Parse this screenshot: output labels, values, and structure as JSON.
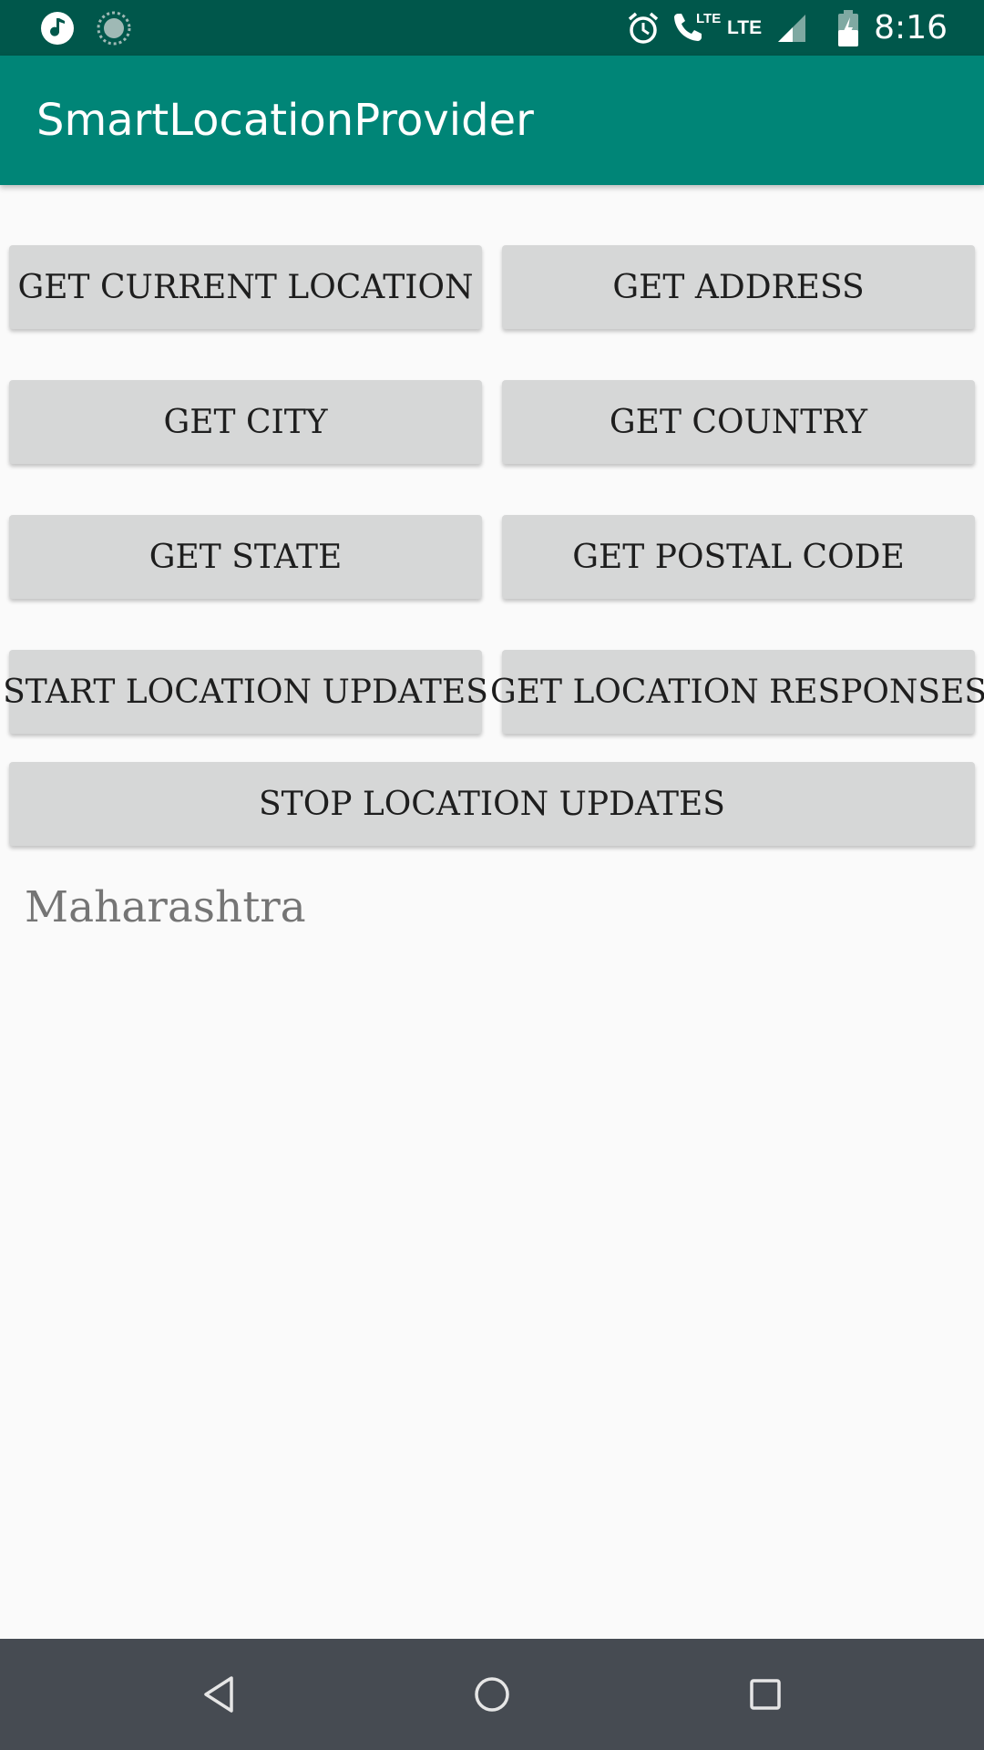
{
  "status_bar": {
    "time": "8:16",
    "lte_label": "LTE",
    "lte_small_label": "LTE",
    "icons": [
      "music-icon",
      "sync-icon",
      "alarm-icon",
      "call-lte-icon",
      "signal-icon",
      "battery-icon"
    ]
  },
  "app_bar": {
    "title": "SmartLocationProvider"
  },
  "buttons": {
    "get_current_location": "GET CURRENT LOCATION",
    "get_address": "GET ADDRESS",
    "get_city": "GET CITY",
    "get_country": "GET COUNTRY",
    "get_state": "GET STATE",
    "get_postal_code": "GET POSTAL CODE",
    "start_location_updates": "START LOCATION UPDATES",
    "get_location_responses": "GET LOCATION RESPONSES",
    "stop_location_updates": "STOP LOCATION UPDATES"
  },
  "result": {
    "text": "Maharashtra"
  },
  "nav_bar": {
    "icons": [
      "back-icon",
      "home-icon",
      "recents-icon"
    ]
  },
  "colors": {
    "status_bar": "#00574b",
    "app_bar": "#008577",
    "background": "#fafafa",
    "button": "#d6d7d7",
    "nav_bar": "#464b52"
  }
}
